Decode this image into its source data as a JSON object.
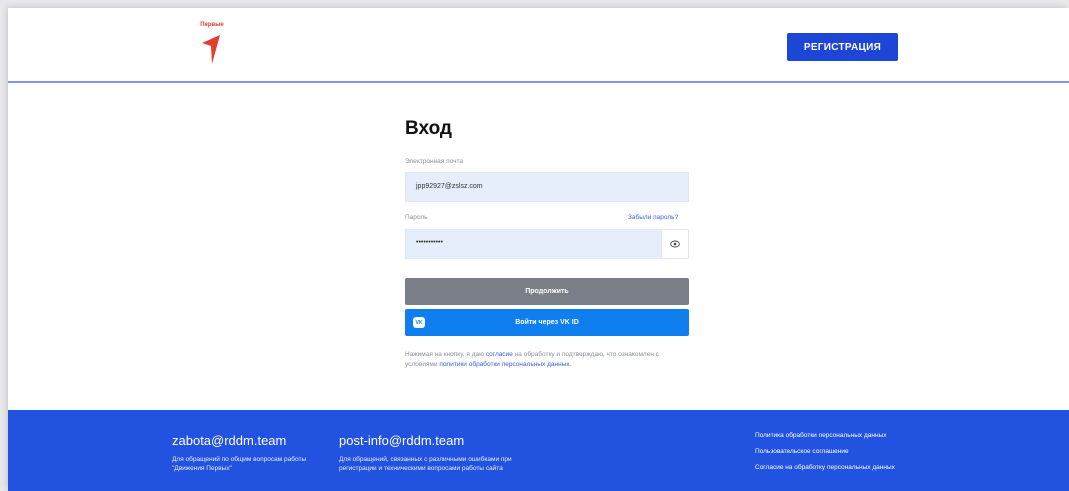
{
  "header": {
    "logo_text": "Первые",
    "register_label": "РЕГИСТРАЦИЯ"
  },
  "login": {
    "title": "Вход",
    "email_label": "Электронная почта",
    "email_value": "jpp92927@zslsz.com",
    "password_label": "Пароль",
    "forgot_label": "Забыли пароль?",
    "password_value": "•••••••••••",
    "continue_label": "Продолжить",
    "vk_label": "Войти через VK ID",
    "vk_icon_text": "VK",
    "consent_part1": "Нажимая на кнопку, я даю ",
    "consent_link1": "согласие",
    "consent_part2": " на обработку и подтверждаю, что ознакомлен с условиями ",
    "consent_link2": "политики обработки персональных данных",
    "consent_part3": "."
  },
  "footer": {
    "contact1_email": "zabota@rddm.team",
    "contact1_desc": "Для обращений по общим вопросам работы \"Движения Первых\"",
    "contact2_email": "post-info@rddm.team",
    "contact2_desc": "Для обращений, связанных с различными ошибками при регистрации и техническими вопросами работы сайта",
    "links": [
      "Политика обработки персональных данных",
      "Пользовательское соглашение",
      "Согласие на обработку персональных данных"
    ]
  },
  "colors": {
    "brand_blue": "#1e46d6",
    "footer_blue": "#2252e0",
    "vk_blue": "#0f7ff0",
    "logo_red": "#e43d2f"
  },
  "icons": [
    "logo-icon",
    "eye-icon",
    "vk-icon"
  ]
}
